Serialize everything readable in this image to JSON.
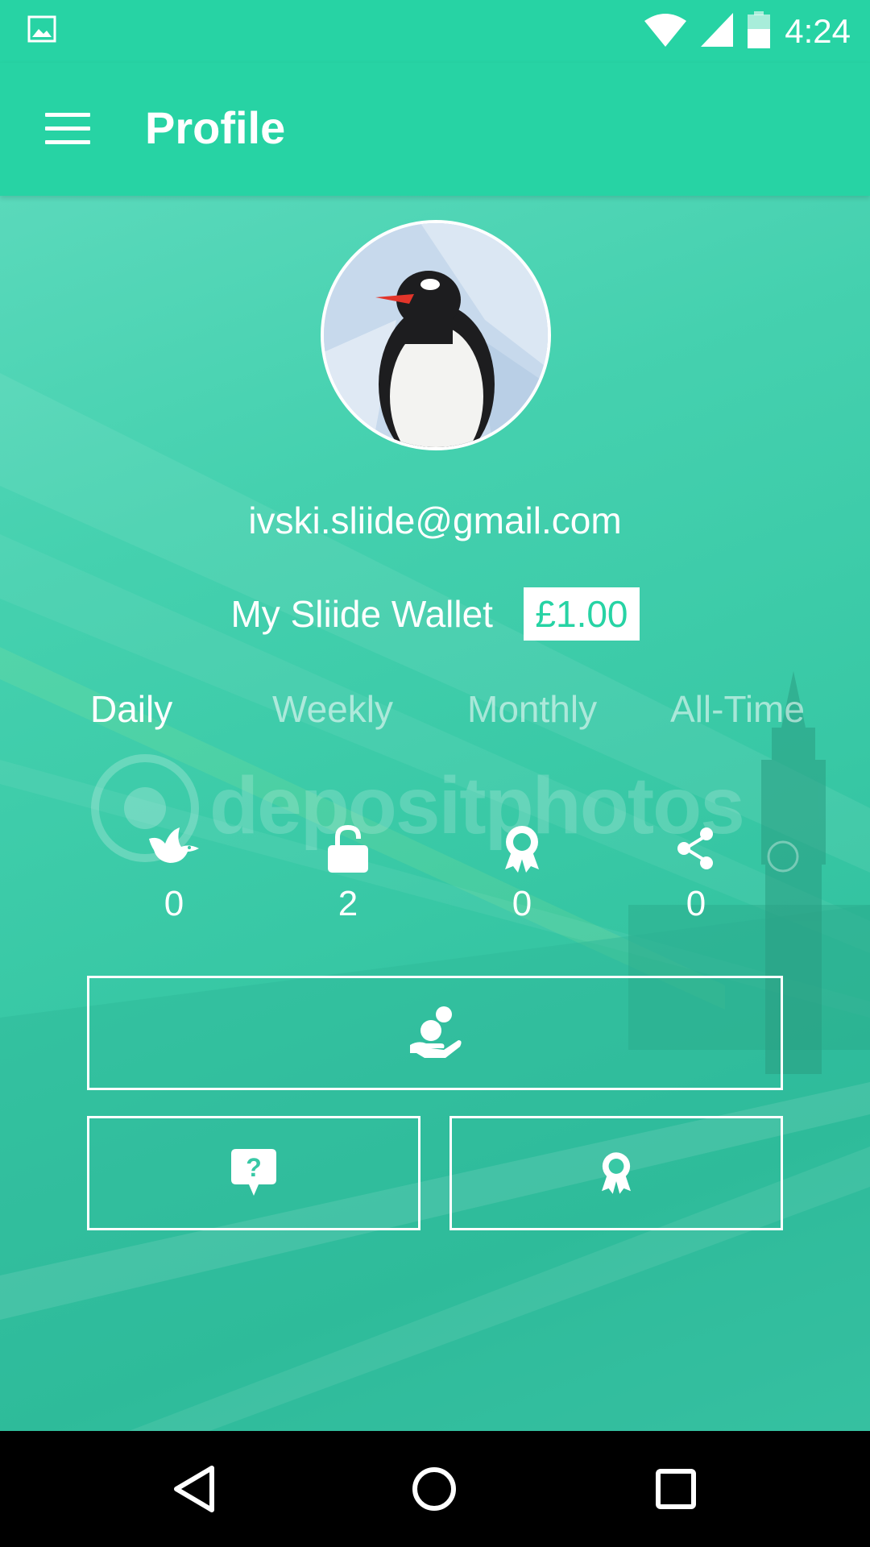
{
  "status_bar": {
    "time": "4:24",
    "icons": [
      "image-notification-icon",
      "wifi-icon",
      "cell-signal-icon",
      "battery-icon"
    ]
  },
  "app_bar": {
    "title": "Profile",
    "menu_icon": "hamburger-menu-icon"
  },
  "profile": {
    "email": "ivski.sliide@gmail.com",
    "wallet_label": "My Sliide Wallet",
    "wallet_value": "£1.00"
  },
  "tabs": [
    {
      "label": "Daily",
      "active": true
    },
    {
      "label": "Weekly",
      "active": false
    },
    {
      "label": "Monthly",
      "active": false
    },
    {
      "label": "All-Time",
      "active": false
    }
  ],
  "stats": [
    {
      "icon": "bird-icon",
      "count": "0"
    },
    {
      "icon": "unlock-icon",
      "count": "2"
    },
    {
      "icon": "award-icon",
      "count": "0"
    },
    {
      "icon": "share-icon",
      "count": "0"
    }
  ],
  "actions": {
    "primary_icon": "give-hand-icon",
    "help_icon": "help-question-icon",
    "rewards_icon": "award-icon"
  },
  "watermark": "depositphotos",
  "colors": {
    "primary": "#27d3a4",
    "white": "#ffffff",
    "nav_background": "#000000"
  },
  "nav_bar": [
    "back-icon",
    "home-icon",
    "recents-icon"
  ]
}
